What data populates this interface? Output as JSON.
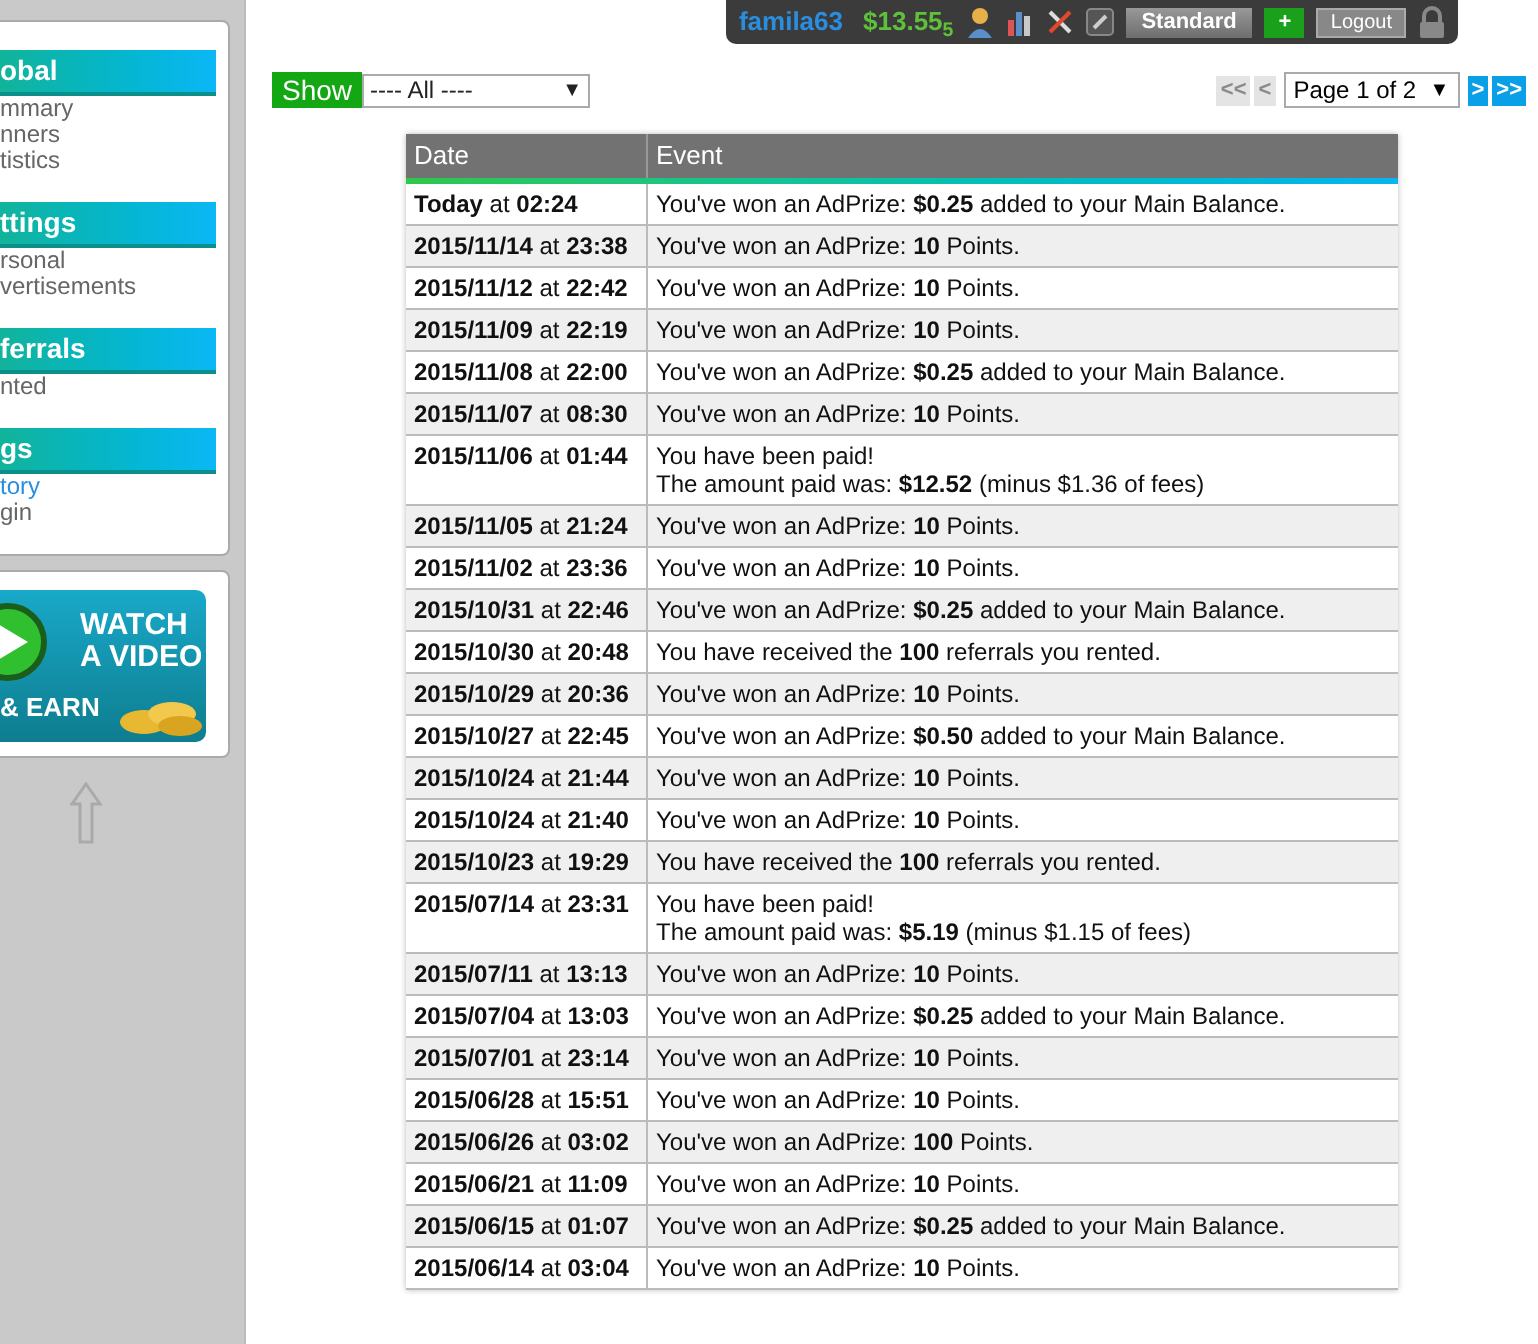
{
  "user_bar": {
    "username": "famila63",
    "balance": "$13.55$_{5}$",
    "membership": "Standard",
    "upgrade": "+",
    "logout": "Logout"
  },
  "sidebar": {
    "sections": [
      {
        "title": "obal",
        "items": [
          {
            "label": "mmary",
            "selected": false
          },
          {
            "label": "nners",
            "selected": false
          },
          {
            "label": "tistics",
            "selected": false
          }
        ]
      },
      {
        "title": "ttings",
        "items": [
          {
            "label": "rsonal",
            "selected": false
          },
          {
            "label": "vertisements",
            "selected": false
          }
        ]
      },
      {
        "title": "ferrals",
        "items": [
          {
            "label": "nted",
            "selected": false
          }
        ]
      },
      {
        "title": "gs",
        "items": [
          {
            "label": "tory",
            "selected": true
          },
          {
            "label": "gin",
            "selected": false
          }
        ]
      }
    ],
    "banner": {
      "title": "WATCH\nA VIDEO",
      "subtitle": "& EARN"
    }
  },
  "filter": {
    "label": "Show",
    "value": "---- All ----",
    "arrow": "▼"
  },
  "pagination": {
    "first": "<<",
    "prev": "<",
    "page": "Page 1 of 2",
    "page_arrow": "▼",
    "next": ">",
    "last": ">>",
    "first_disabled": true,
    "prev_disabled": true
  },
  "table": {
    "columns": [
      "Date",
      "Event"
    ],
    "rows": [
      {
        "date": "**Today** at **02:24**",
        "event": [
          "You've won an AdPrize: **$0.25** added to your Main Balance."
        ]
      },
      {
        "date": "**2015/11/14** at **23:38**",
        "event": [
          "You've won an AdPrize: **10** Points."
        ]
      },
      {
        "date": "**2015/11/12** at **22:42**",
        "event": [
          "You've won an AdPrize: **10** Points."
        ]
      },
      {
        "date": "**2015/11/09** at **22:19**",
        "event": [
          "You've won an AdPrize: **10** Points."
        ]
      },
      {
        "date": "**2015/11/08** at **22:00**",
        "event": [
          "You've won an AdPrize: **$0.25** added to your Main Balance."
        ]
      },
      {
        "date": "**2015/11/07** at **08:30**",
        "event": [
          "You've won an AdPrize: **10** Points."
        ]
      },
      {
        "date": "**2015/11/06** at **01:44**",
        "event": [
          "You have been paid!",
          "The amount paid was: **$12.52** (minus $1.36 of fees)"
        ]
      },
      {
        "date": "**2015/11/05** at **21:24**",
        "event": [
          "You've won an AdPrize: **10** Points."
        ]
      },
      {
        "date": "**2015/11/02** at **23:36**",
        "event": [
          "You've won an AdPrize: **10** Points."
        ]
      },
      {
        "date": "**2015/10/31** at **22:46**",
        "event": [
          "You've won an AdPrize: **$0.25** added to your Main Balance."
        ]
      },
      {
        "date": "**2015/10/30** at **20:48**",
        "event": [
          "You have received the **100** referrals you rented."
        ]
      },
      {
        "date": "**2015/10/29** at **20:36**",
        "event": [
          "You've won an AdPrize: **10** Points."
        ]
      },
      {
        "date": "**2015/10/27** at **22:45**",
        "event": [
          "You've won an AdPrize: **$0.50** added to your Main Balance."
        ]
      },
      {
        "date": "**2015/10/24** at **21:44**",
        "event": [
          "You've won an AdPrize: **10** Points."
        ]
      },
      {
        "date": "**2015/10/24** at **21:40**",
        "event": [
          "You've won an AdPrize: **10** Points."
        ]
      },
      {
        "date": "**2015/10/23** at **19:29**",
        "event": [
          "You have received the **100** referrals you rented."
        ]
      },
      {
        "date": "**2015/07/14** at **23:31**",
        "event": [
          "You have been paid!",
          "The amount paid was: **$5.19** (minus $1.15 of fees)"
        ]
      },
      {
        "date": "**2015/07/11** at **13:13**",
        "event": [
          "You've won an AdPrize: **10** Points."
        ]
      },
      {
        "date": "**2015/07/04** at **13:03**",
        "event": [
          "You've won an AdPrize: **$0.25** added to your Main Balance."
        ]
      },
      {
        "date": "**2015/07/01** at **23:14**",
        "event": [
          "You've won an AdPrize: **10** Points."
        ]
      },
      {
        "date": "**2015/06/28** at **15:51**",
        "event": [
          "You've won an AdPrize: **10** Points."
        ]
      },
      {
        "date": "**2015/06/26** at **03:02**",
        "event": [
          "You've won an AdPrize: **100** Points."
        ]
      },
      {
        "date": "**2015/06/21** at **11:09**",
        "event": [
          "You've won an AdPrize: **10** Points."
        ]
      },
      {
        "date": "**2015/06/15** at **01:07**",
        "event": [
          "You've won an AdPrize: **$0.25** added to your Main Balance."
        ]
      },
      {
        "date": "**2015/06/14** at **03:04**",
        "event": [
          "You've won an AdPrize: **10** Points."
        ]
      }
    ]
  }
}
